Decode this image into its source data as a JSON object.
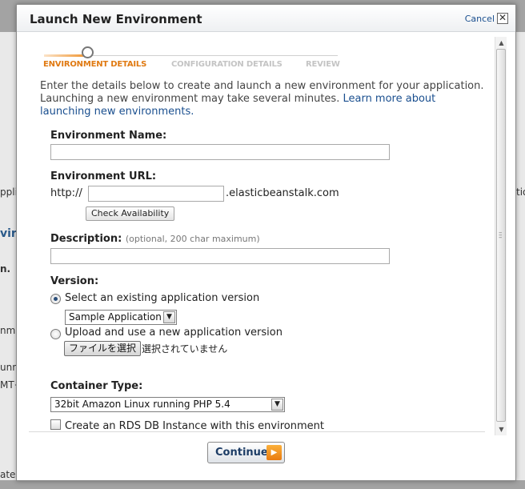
{
  "background": {
    "fragments": [
      "ppli",
      "virc",
      "n.",
      "nm",
      "unn",
      "MT+",
      "ate",
      "tion"
    ]
  },
  "dialog": {
    "title": "Launch New Environment",
    "cancel_label": "Cancel",
    "close_glyph": "✕"
  },
  "wizard": {
    "steps": [
      "ENVIRONMENT DETAILS",
      "CONFIGURATION DETAILS",
      "REVIEW"
    ],
    "current_step": 1
  },
  "intro": {
    "text": "Enter the details below to create and launch a new environment for your application. Launching a new environment may take several minutes. ",
    "link": "Learn more about launching new environments."
  },
  "form": {
    "env_name_label": "Environment Name:",
    "env_name_value": "",
    "env_url_label": "Environment URL:",
    "url_prefix": "http://",
    "url_value": "",
    "url_suffix": ".elasticbeanstalk.com",
    "check_availability": "Check Availability",
    "description_label": "Description:",
    "description_hint": "(optional, 200 char maximum)",
    "description_value": "",
    "version_label": "Version:",
    "version_option_existing": "Select an existing application version",
    "version_selected": "Sample Application",
    "version_option_upload": "Upload and use a new application version",
    "file_button": "ファイルを選択",
    "file_status": "選択されていません",
    "container_label": "Container Type:",
    "container_selected": "32bit Amazon Linux running PHP 5.4",
    "rds_label": "Create an RDS DB Instance with this environment"
  },
  "footer": {
    "continue_label": "Continue",
    "continue_icon": "play-arrow-icon"
  },
  "colors": {
    "accent_orange": "#e07a12",
    "link_blue": "#1a4f8f",
    "inactive_step": "#c4c4c4"
  }
}
